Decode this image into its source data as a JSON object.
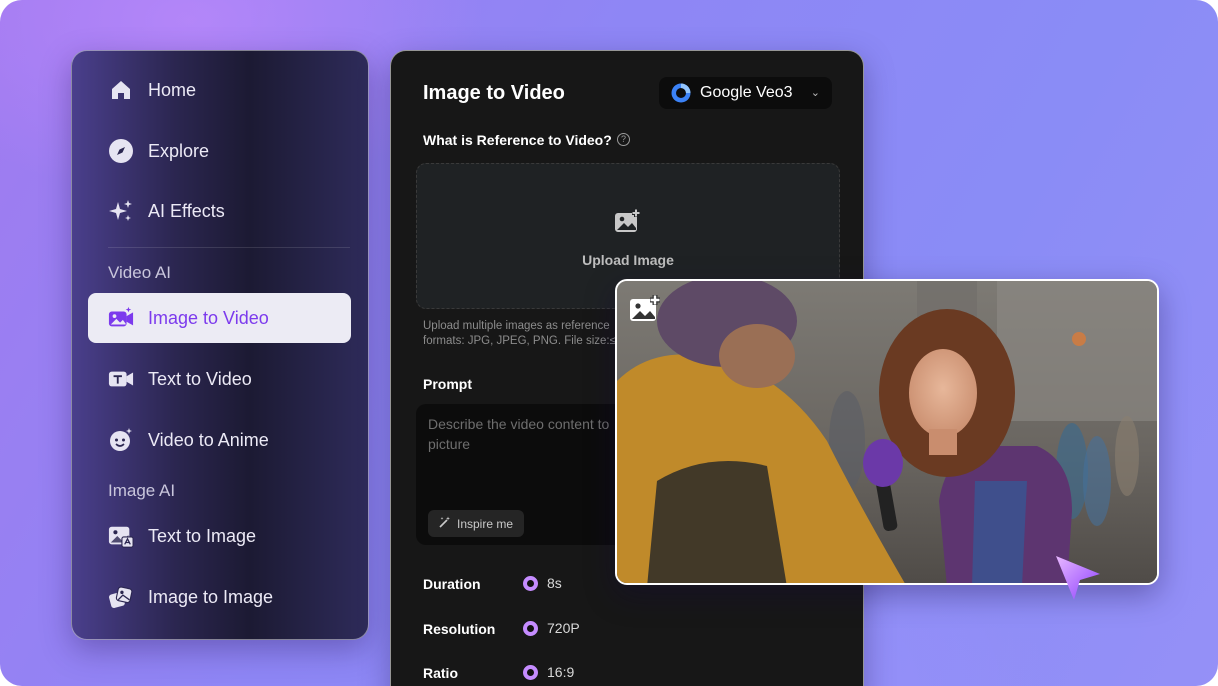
{
  "sidebar": {
    "items": [
      {
        "label": "Home",
        "icon": "home-icon"
      },
      {
        "label": "Explore",
        "icon": "compass-icon"
      },
      {
        "label": "AI Effects",
        "icon": "sparkle-icon"
      }
    ],
    "video_section": {
      "title": "Video AI",
      "items": [
        {
          "label": "Image to Video",
          "icon": "image-video-icon",
          "active": true
        },
        {
          "label": "Text to Video",
          "icon": "text-video-icon"
        },
        {
          "label": "Video to Anime",
          "icon": "anime-face-icon"
        }
      ]
    },
    "image_section": {
      "title": "Image AI",
      "items": [
        {
          "label": "Text to Image",
          "icon": "text-image-icon"
        },
        {
          "label": "Image to Image",
          "icon": "image-image-icon"
        }
      ]
    }
  },
  "panel": {
    "title": "Image to Video",
    "model": {
      "name": "Google Veo3",
      "icon": "veo-logo-icon"
    },
    "reference_label": "What is Reference to Video?",
    "upload": {
      "label": "Upload Image",
      "note_line1": "Upload multiple images as reference",
      "note_line2": "formats: JPG, JPEG, PNG. File size:≤"
    },
    "prompt": {
      "label": "Prompt",
      "placeholder": "Describe the video content to picture",
      "inspire_label": "Inspire me"
    },
    "options": [
      {
        "label": "Duration",
        "value": "8s"
      },
      {
        "label": "Resolution",
        "value": "720P"
      },
      {
        "label": "Ratio",
        "value": "16:9"
      }
    ]
  },
  "colors": {
    "accent": "#7c3aed",
    "radio": "#c58cff",
    "panel_bg": "#171717",
    "background": "#8e86f5"
  }
}
